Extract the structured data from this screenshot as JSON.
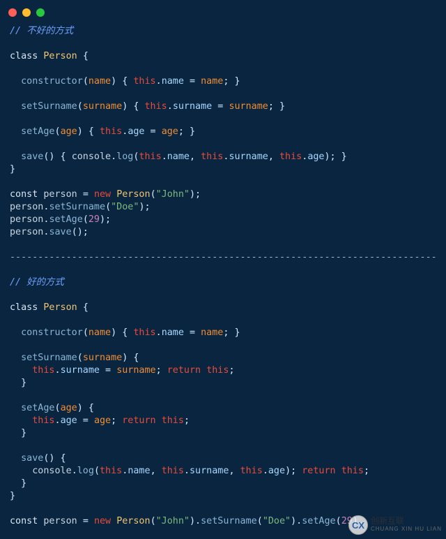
{
  "titlebar": {
    "buttons": [
      "close",
      "minimize",
      "zoom"
    ]
  },
  "code": {
    "bad_comment": "// 不好的方式",
    "good_comment": "// 好的方式",
    "class_kw": "class",
    "class_name": "Person",
    "constructor_kw": "constructor",
    "param_name": "name",
    "this_kw": "this",
    "prop_name": "name",
    "set_surname_fn": "setSurname",
    "param_surname": "surname",
    "prop_surname": "surname",
    "set_age_fn": "setAge",
    "param_age": "age",
    "prop_age": "age",
    "save_fn": "save",
    "console_obj": "console",
    "log_fn": "log",
    "const_kw": "const",
    "person_var": "person",
    "new_kw": "new",
    "john_str": "\"John\"",
    "doe_str": "\"Doe\"",
    "age_num": "29",
    "return_kw": "return",
    "separator": "----------------------------------------------------------------------------"
  },
  "watermark": {
    "badge": "CX",
    "cn": "创新互联",
    "py": "CHUANG XIN HU LIAN"
  }
}
